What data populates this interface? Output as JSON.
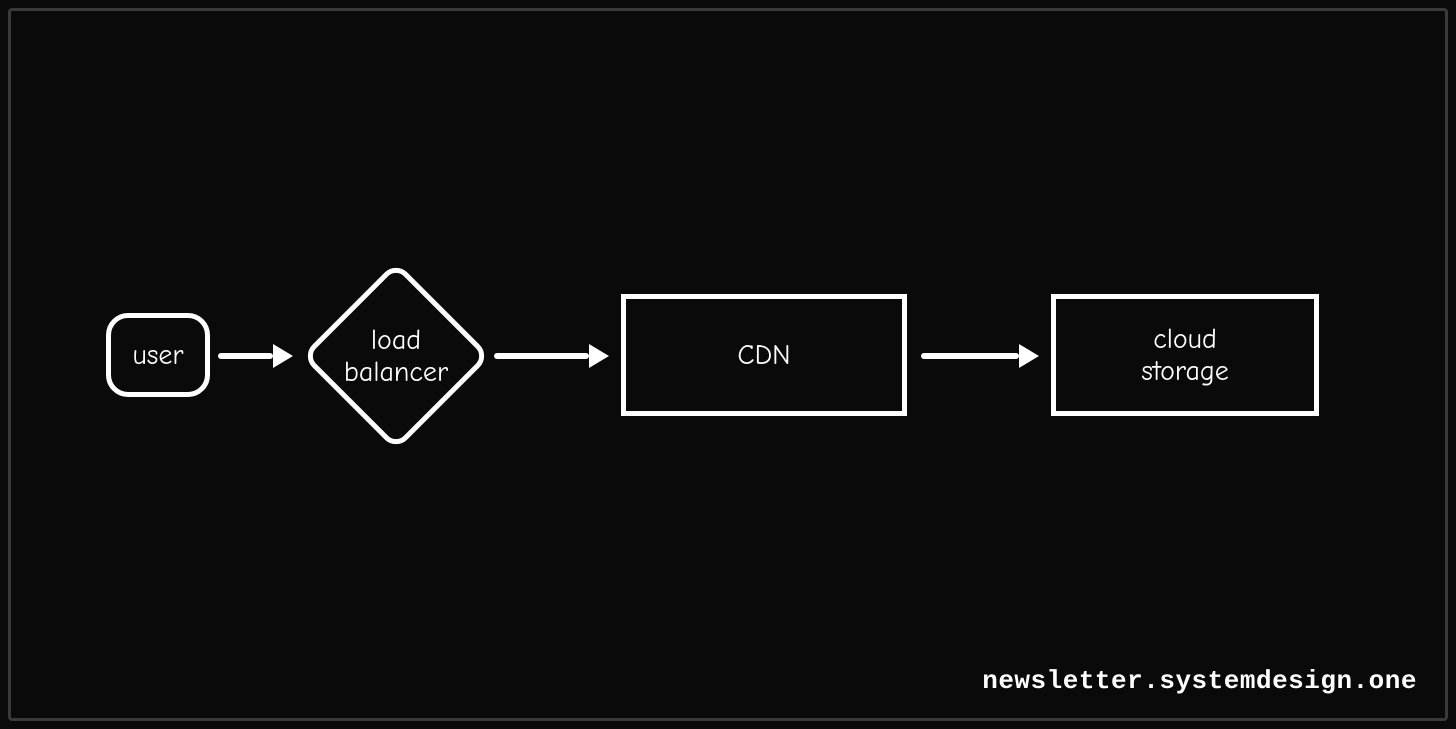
{
  "nodes": {
    "user": "user",
    "load_balancer_line1": "load",
    "load_balancer_line2": "balancer",
    "cdn": "CDN",
    "cloud_line1": "cloud",
    "cloud_line2": "storage"
  },
  "attribution": "newsletter.systemdesign.one",
  "flow": [
    "user",
    "load balancer",
    "CDN",
    "cloud storage"
  ]
}
